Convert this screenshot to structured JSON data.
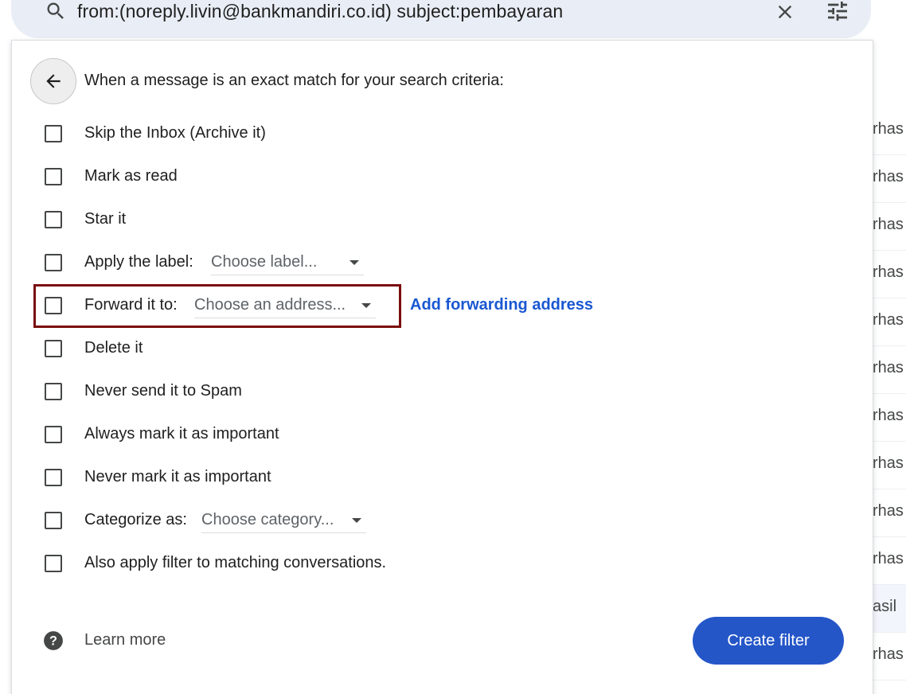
{
  "search": {
    "query": "from:(noreply.livin@bankmandiri.co.id) subject:pembayaran"
  },
  "background_rows": [
    "rhas",
    "rhas",
    "rhas",
    "rhas",
    "rhas",
    "rhas",
    "rhas",
    "rhas",
    "rhas",
    "rhas",
    "asil",
    "rhas"
  ],
  "filter": {
    "header": "When a message is an exact match for your search criteria:",
    "options": {
      "skip_inbox": "Skip the Inbox (Archive it)",
      "mark_read": "Mark as read",
      "star_it": "Star it",
      "apply_label": "Apply the label:",
      "apply_label_placeholder": "Choose label...",
      "forward_to": "Forward it to:",
      "forward_placeholder": "Choose an address...",
      "add_forwarding": "Add forwarding address",
      "delete_it": "Delete it",
      "never_spam": "Never send it to Spam",
      "always_important": "Always mark it as important",
      "never_important": "Never mark it as important",
      "categorize": "Categorize as:",
      "categorize_placeholder": "Choose category...",
      "also_apply": "Also apply filter to matching conversations."
    },
    "learn_more": "Learn more",
    "create_filter": "Create filter"
  },
  "colors": {
    "primary_button": "#2456c8",
    "link": "#1a57d2",
    "highlight_box": "#7a0d0d"
  },
  "icons": {
    "search": "search-icon",
    "clear": "close-icon",
    "tune": "tune-icon",
    "back": "arrow-back-icon",
    "help": "help-icon"
  }
}
